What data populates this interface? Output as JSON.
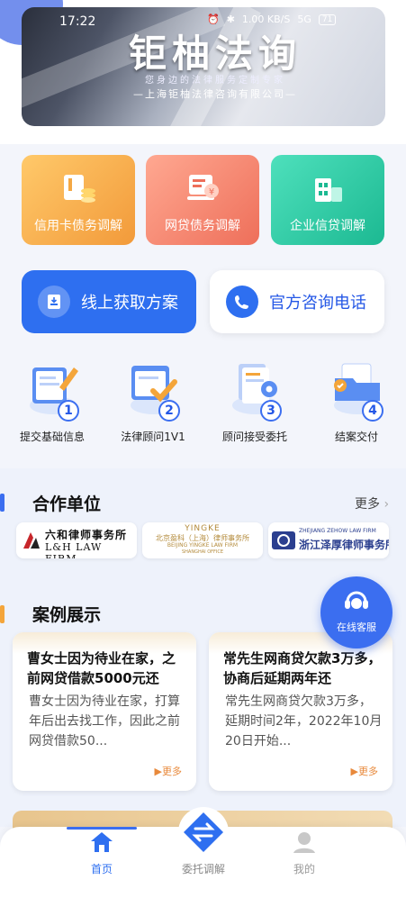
{
  "status_bar": {
    "time": "17:22",
    "speed": "1.00 KB/S",
    "network": "5G",
    "battery": "71"
  },
  "banner": {
    "title": "钜柚法询",
    "subtitle": "您身边的法律服务定制专家",
    "company": "—上海钜柚法律咨询有限公司—"
  },
  "services": [
    {
      "label": "信用卡债务调解",
      "color": "#f4a844",
      "icon": "credit-card-icon"
    },
    {
      "label": "网贷债务调解",
      "color": "#f07b63",
      "icon": "online-loan-icon"
    },
    {
      "label": "企业信贷调解",
      "color": "#2fc9a5",
      "icon": "enterprise-building-icon"
    }
  ],
  "actions": {
    "online_plan": "线上获取方案",
    "hotline": "官方咨询电话"
  },
  "steps": [
    {
      "label": "提交基础信息",
      "num": "1"
    },
    {
      "label": "法律顾问1V1",
      "num": "2"
    },
    {
      "label": "顾问接受委托",
      "num": "3"
    },
    {
      "label": "结案交付",
      "num": "4"
    }
  ],
  "partners": {
    "title": "合作单位",
    "more": "更多",
    "items": [
      {
        "cn": "六和律师事务所",
        "en": "L&H LAW FIRM"
      },
      {
        "brand": "YINGKE",
        "cn": "北京盈科（上海）律师事务所",
        "en": "BEIJING YINGKE LAW FIRM",
        "office": "SHANGHAI OFFICE"
      },
      {
        "en": "ZHEJIANG ZEHOW LAW FIRM",
        "cn": "浙江泽厚律师事务所"
      }
    ]
  },
  "cases": {
    "title": "案例展示",
    "items": [
      {
        "title": "曹女士因为待业在家，之前网贷借款5000元还",
        "desc": "曹女士因为待业在家，打算年后出去找工作，因此之前网贷借款50...",
        "more": "▶更多"
      },
      {
        "title": "常先生网商贷欠款3万多，协商后延期两年还",
        "desc": "常先生网商贷欠款3万多，延期时间2年，2022年10月20日开始...",
        "more": "▶更多"
      }
    ]
  },
  "customer_service": "在线客服",
  "bottom_nav": {
    "home": "首页",
    "delegate": "委托调解",
    "mine": "我的"
  },
  "colors": {
    "accent": "#3b6ef0",
    "primary_button": "#2e6ff0"
  }
}
